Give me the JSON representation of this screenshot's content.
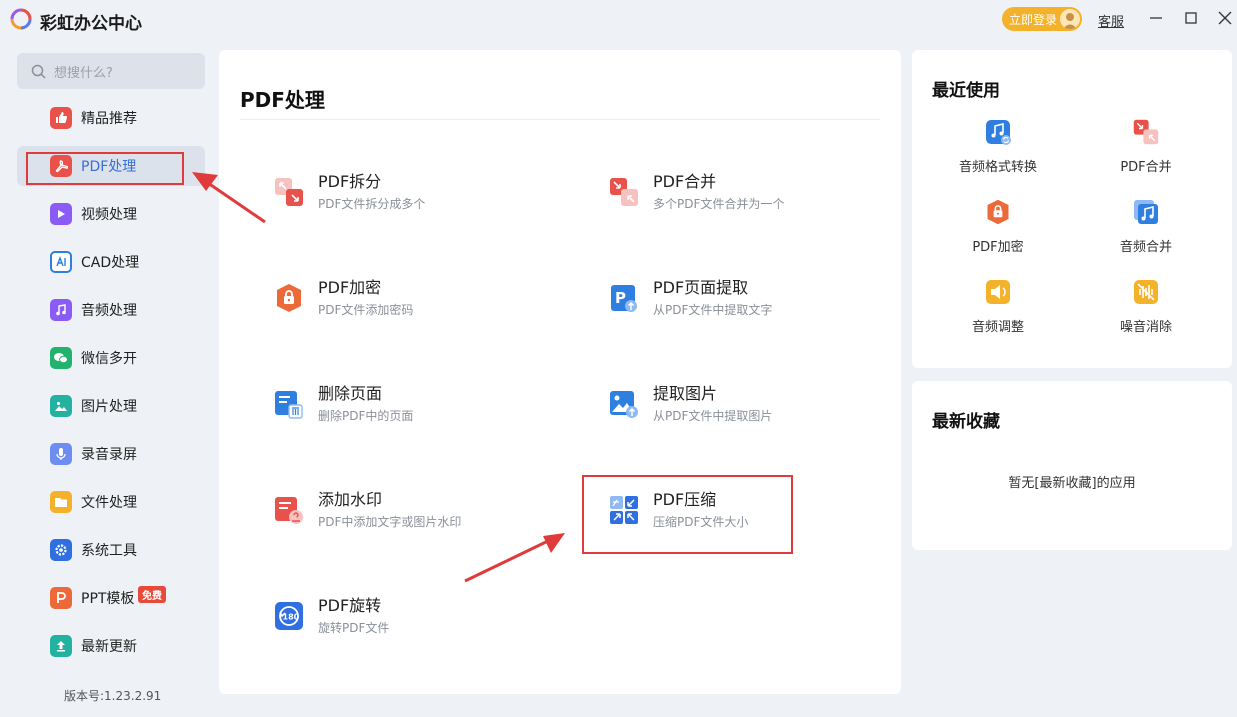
{
  "app": {
    "title": "彩虹办公中心"
  },
  "header": {
    "login_label": "立即登录",
    "service_label": "客服"
  },
  "search": {
    "placeholder": "想搜什么?"
  },
  "sidebar": {
    "items": [
      {
        "label": "精品推荐",
        "icon": "thumbs-up-icon",
        "color": "#e8524a"
      },
      {
        "label": "PDF处理",
        "icon": "pdf-icon",
        "color": "#e8524a"
      },
      {
        "label": "视频处理",
        "icon": "play-icon",
        "color": "#8a5cf5"
      },
      {
        "label": "CAD处理",
        "icon": "cad-icon",
        "color": "#2f7fe0"
      },
      {
        "label": "音频处理",
        "icon": "music-icon",
        "color": "#8a5cf5"
      },
      {
        "label": "微信多开",
        "icon": "wechat-icon",
        "color": "#23b26d"
      },
      {
        "label": "图片处理",
        "icon": "image-icon",
        "color": "#23b2a0"
      },
      {
        "label": "录音录屏",
        "icon": "microphone-icon",
        "color": "#6d8ef0"
      },
      {
        "label": "文件处理",
        "icon": "folder-icon",
        "color": "#f4b12a"
      },
      {
        "label": "系统工具",
        "icon": "gear-icon",
        "color": "#2f6fe0"
      },
      {
        "label": "PPT模板",
        "icon": "ppt-icon",
        "color": "#ec6a3a",
        "badge": "免费"
      },
      {
        "label": "最新更新",
        "icon": "upload-icon",
        "color": "#23b2a0"
      }
    ],
    "version": "版本号:1.23.2.91"
  },
  "main": {
    "title": "PDF处理",
    "tools": [
      {
        "name": "PDF拆分",
        "desc": "PDF文件拆分成多个",
        "icon": "pdf-split-icon"
      },
      {
        "name": "PDF合并",
        "desc": "多个PDF文件合并为一个",
        "icon": "pdf-merge-icon"
      },
      {
        "name": "PDF加密",
        "desc": "PDF文件添加密码",
        "icon": "pdf-encrypt-icon"
      },
      {
        "name": "PDF页面提取",
        "desc": "从PDF文件中提取文字",
        "icon": "pdf-extract-page-icon"
      },
      {
        "name": "删除页面",
        "desc": "删除PDF中的页面",
        "icon": "delete-page-icon"
      },
      {
        "name": "提取图片",
        "desc": "从PDF文件中提取图片",
        "icon": "extract-image-icon"
      },
      {
        "name": "添加水印",
        "desc": "PDF中添加文字或图片水印",
        "icon": "watermark-icon"
      },
      {
        "name": "PDF压缩",
        "desc": "压缩PDF文件大小",
        "icon": "pdf-compress-icon"
      },
      {
        "name": "PDF旋转",
        "desc": "旋转PDF文件",
        "icon": "pdf-rotate-icon"
      }
    ]
  },
  "recent": {
    "title": "最近使用",
    "items": [
      {
        "label": "音频格式转换",
        "icon": "audio-convert-icon"
      },
      {
        "label": "PDF合并",
        "icon": "pdf-merge-icon"
      },
      {
        "label": "PDF加密",
        "icon": "pdf-encrypt-icon"
      },
      {
        "label": "音频合并",
        "icon": "audio-merge-icon"
      },
      {
        "label": "音频调整",
        "icon": "volume-icon"
      },
      {
        "label": "噪音消除",
        "icon": "noise-removal-icon"
      }
    ]
  },
  "favorites": {
    "title": "最新收藏",
    "empty_text": "暂无[最新收藏]的应用"
  },
  "colors": {
    "accent": "#3a6fd8",
    "annotation": "#e03a3a",
    "background": "#eef1f6"
  }
}
